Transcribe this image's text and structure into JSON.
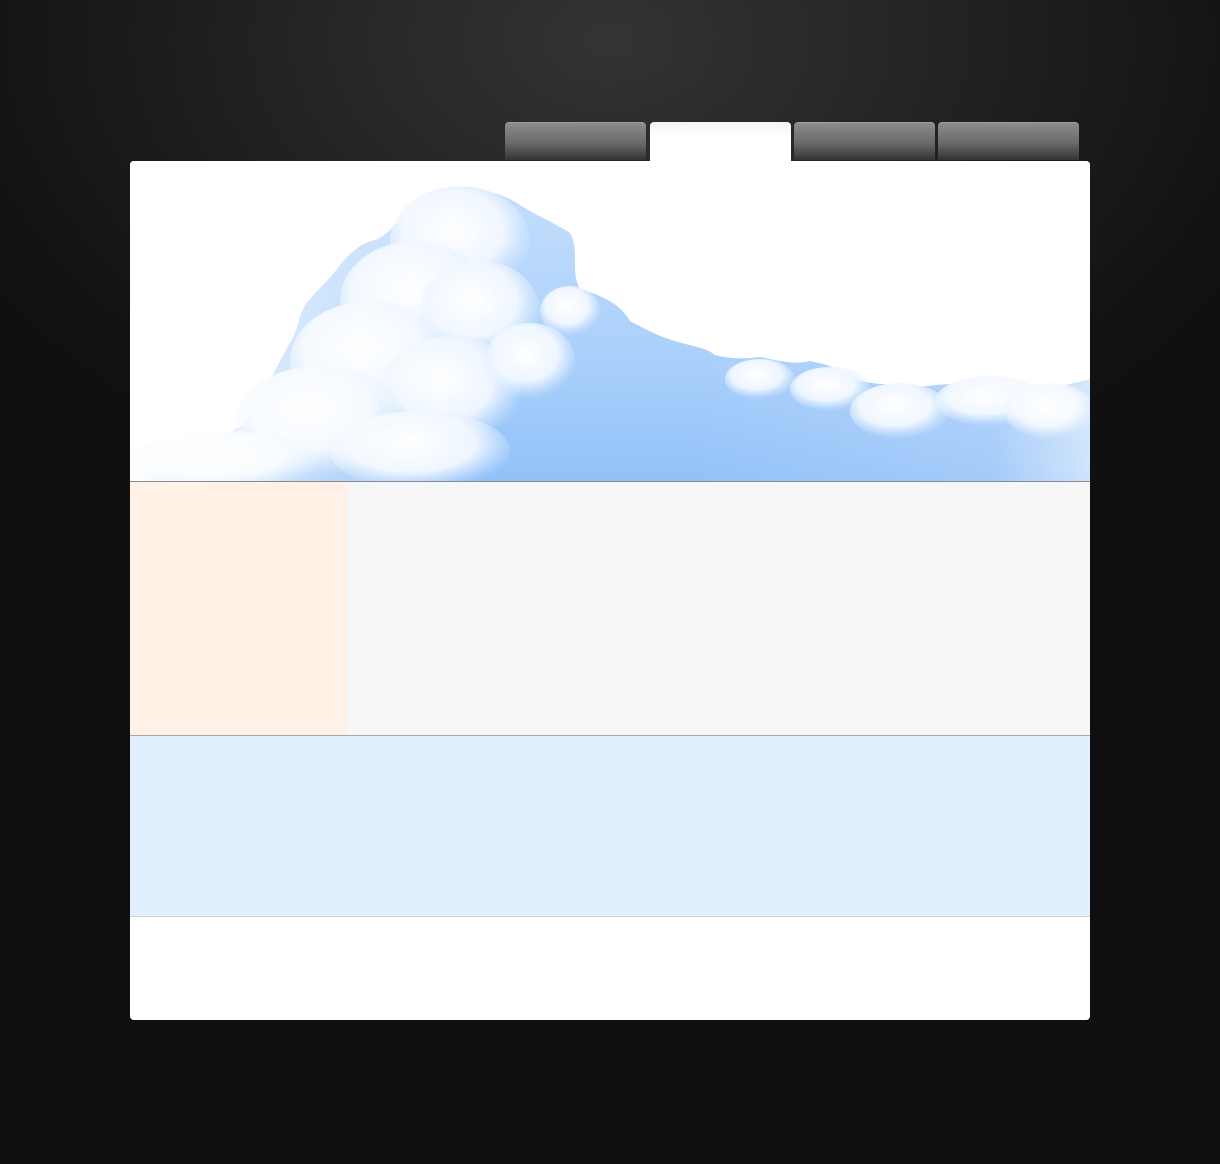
{
  "nav": {
    "tabs": [
      {
        "label": ""
      },
      {
        "label": ""
      },
      {
        "label": ""
      },
      {
        "label": ""
      }
    ],
    "active_index": 1
  },
  "colors": {
    "page_background": "#111111",
    "panel_background": "#ffffff",
    "sky_blue": "#9fc9fa",
    "sidebar_background": "#fff1e5",
    "content_background": "#f6f6f6",
    "info_band_background": "#e2f0fd"
  },
  "banner": {
    "image": "cloud-sky-image"
  }
}
